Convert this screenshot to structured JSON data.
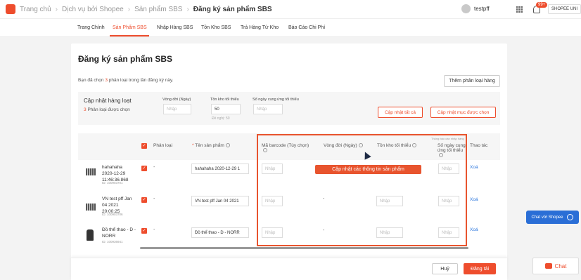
{
  "header": {
    "breadcrumb": [
      "Trang chủ",
      "Dịch vụ bởi Shopee",
      "Sản phẩm SBS",
      "Đăng ký sản phẩm SBS"
    ],
    "breadcrumb_sep": "›",
    "username": "testpff",
    "notification_count": "99+",
    "shop_label": "SHOPEE UNI"
  },
  "tabs": [
    {
      "label": "Trang Chính",
      "active": false
    },
    {
      "label": "Sản Phẩm SBS",
      "active": true
    },
    {
      "label": "Nhập Hàng SBS",
      "active": false
    },
    {
      "label": "Tồn Kho SBS",
      "active": false
    },
    {
      "label": "Trả Hàng Từ Kho",
      "active": false
    },
    {
      "label": "Báo Cáo Chi Phí",
      "active": false
    }
  ],
  "page": {
    "title": "Đăng ký sản phẩm SBS",
    "info_prefix": "Bạn đã chọn",
    "info_count": "3",
    "info_suffix": "phân loại trong lần đăng ký này.",
    "add_variant_button": "Thêm phân loại hàng"
  },
  "bulk_update": {
    "title": "Cập nhật hàng loạt",
    "selected_count": "3",
    "selected_text": "Phân loại được chọn",
    "fields": [
      {
        "label": "Vòng đời (Ngày)",
        "value": "",
        "placeholder": "Nhập"
      },
      {
        "label": "Tồn kho tối thiểu",
        "value": "50",
        "placeholder": "Nhập",
        "hint": "Đề nghị: 50"
      },
      {
        "label": "Số ngày cung ứng tối thiểu",
        "value": "",
        "placeholder": "Nhập"
      }
    ],
    "update_all_button": "Cập nhật tất cả",
    "update_selected_button": "Cập nhật mục được chọn"
  },
  "table": {
    "columns": {
      "variant": "Phân loại",
      "product_name": "Tên sản phẩm",
      "barcode": "Mã barcode (Tùy chọn)",
      "lifecycle": "Vòng đời (Ngày)",
      "min_stock": "Tồn kho tối thiểu",
      "min_days": "Số ngày cung ứng tối thiểu",
      "min_days_note": "Thông báo cần nhập hàng",
      "actions": "Thao tác"
    },
    "required_mark": "*",
    "placeholder": "Nhập",
    "dash": "-",
    "delete_label": "Xoá",
    "rows": [
      {
        "name": "hahahaha\n2020-12-29\n11:46:36.868",
        "id": "ID: 100903701",
        "variant": "-",
        "product_name": "hahahaha 2020-12-29 1",
        "lifecycle_dash": ""
      },
      {
        "name": "VN test pff Jan\n04 2021\n20:00:25",
        "id": "ID: 100903706",
        "variant": "-",
        "product_name": "VN test pff Jan 04 2021",
        "lifecycle_dash": "-"
      },
      {
        "name": "Đồ thể thao - D -\nNORR",
        "id": "ID: 100936941",
        "variant": "-",
        "product_name": "Đồ thể thao - D - NORR",
        "lifecycle_dash": "-"
      }
    ]
  },
  "annotation": {
    "tooltip": "Cập nhật các thông tin sản phẩm"
  },
  "footer": {
    "cancel_button": "Huỷ",
    "register_button": "Đăng tải"
  },
  "chat": {
    "shopee_chat": "Chat với Shopee",
    "chat_label": "Chat"
  },
  "colors": {
    "brand": "#ee4d2d",
    "link": "#2673dd",
    "chat_blue": "#2a6ed6"
  }
}
